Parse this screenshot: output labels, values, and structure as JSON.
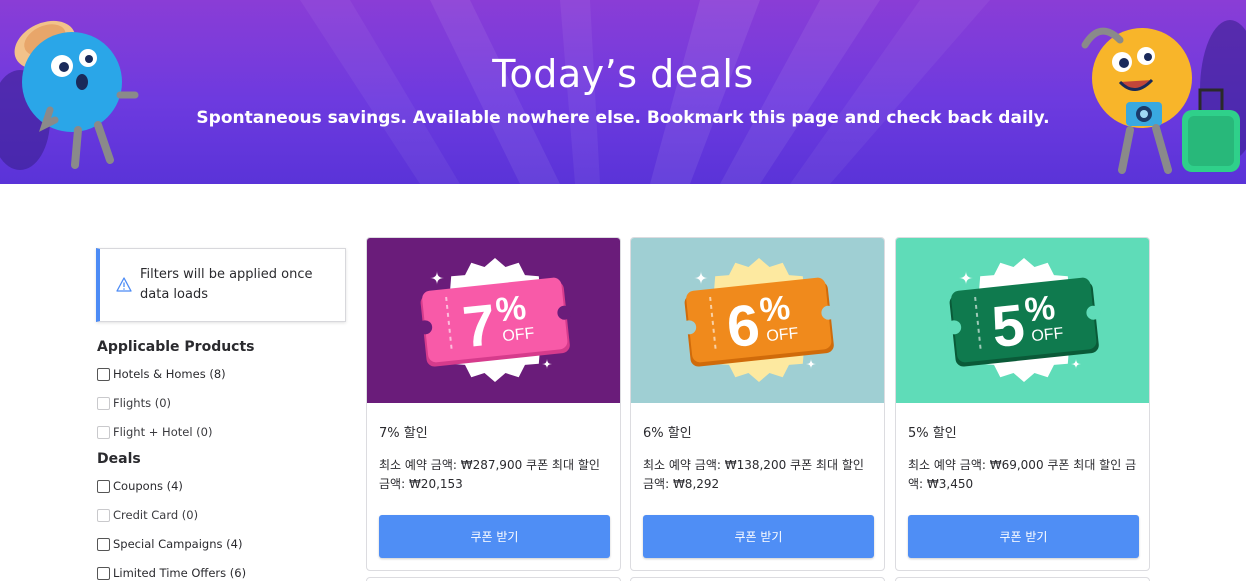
{
  "hero": {
    "title": "Today’s deals",
    "subtitle": "Spontaneous savings. Available nowhere else. Bookmark this page and check back daily."
  },
  "sidebar": {
    "notice": "Filters will be applied once data loads",
    "groups": [
      {
        "title": "Applicable Products",
        "options": [
          {
            "label": "Hotels & Homes (8)",
            "enabled": true
          },
          {
            "label": "Flights (0)",
            "enabled": false
          },
          {
            "label": "Flight + Hotel (0)",
            "enabled": false
          }
        ]
      },
      {
        "title": "Deals",
        "options": [
          {
            "label": "Coupons (4)",
            "enabled": true
          },
          {
            "label": "Credit Card (0)",
            "enabled": false
          },
          {
            "label": "Special Campaigns (4)",
            "enabled": true
          },
          {
            "label": "Limited Time Offers (6)",
            "enabled": true
          }
        ]
      }
    ]
  },
  "deals": [
    {
      "badge_number": "7",
      "badge_percent": "%",
      "badge_off": "OFF",
      "title": "7% 할인",
      "description": "최소 예약 금액: ₩287,900 쿠폰 최대 할인 금액: ₩20,153",
      "button": "쿠폰 받기",
      "bg_color": "#6a1c7a",
      "ticket_color": "#f85aa8",
      "ticket_dark": "#d63b8c",
      "burst_color": "#ffffff"
    },
    {
      "badge_number": "6",
      "badge_percent": "%",
      "badge_off": "OFF",
      "title": "6% 할인",
      "description": "최소 예약 금액: ₩138,200 쿠폰 최대 할인 금액: ₩8,292",
      "button": "쿠폰 받기",
      "bg_color": "#9fcfd3",
      "ticket_color": "#f08a1c",
      "ticket_dark": "#d06b0a",
      "burst_color": "#fde9a0"
    },
    {
      "badge_number": "5",
      "badge_percent": "%",
      "badge_off": "OFF",
      "title": "5% 할인",
      "description": "최소 예약 금액: ₩69,000 쿠폰 최대 할인 금액: ₩3,450",
      "button": "쿠폰 받기",
      "bg_color": "#5fdcb8",
      "ticket_color": "#0f7a4e",
      "ticket_dark": "#0a5a38",
      "burst_color": "#ffffff"
    }
  ],
  "colors": {
    "accent": "#4f8ef5",
    "notice_border": "#4c8bf5",
    "hero_top": "#8a3dd6",
    "hero_bottom": "#5a33d8"
  }
}
